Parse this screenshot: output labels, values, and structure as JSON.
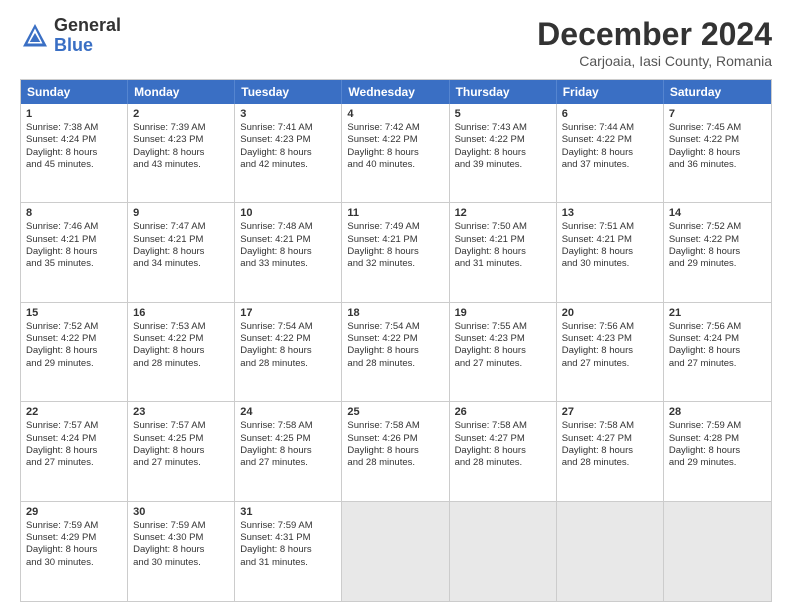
{
  "logo": {
    "line1": "General",
    "line2": "Blue"
  },
  "title": "December 2024",
  "subtitle": "Carjoaia, Iasi County, Romania",
  "header_days": [
    "Sunday",
    "Monday",
    "Tuesday",
    "Wednesday",
    "Thursday",
    "Friday",
    "Saturday"
  ],
  "weeks": [
    [
      {
        "day": "1",
        "text": "Sunrise: 7:38 AM\nSunset: 4:24 PM\nDaylight: 8 hours\nand 45 minutes."
      },
      {
        "day": "2",
        "text": "Sunrise: 7:39 AM\nSunset: 4:23 PM\nDaylight: 8 hours\nand 43 minutes."
      },
      {
        "day": "3",
        "text": "Sunrise: 7:41 AM\nSunset: 4:23 PM\nDaylight: 8 hours\nand 42 minutes."
      },
      {
        "day": "4",
        "text": "Sunrise: 7:42 AM\nSunset: 4:22 PM\nDaylight: 8 hours\nand 40 minutes."
      },
      {
        "day": "5",
        "text": "Sunrise: 7:43 AM\nSunset: 4:22 PM\nDaylight: 8 hours\nand 39 minutes."
      },
      {
        "day": "6",
        "text": "Sunrise: 7:44 AM\nSunset: 4:22 PM\nDaylight: 8 hours\nand 37 minutes."
      },
      {
        "day": "7",
        "text": "Sunrise: 7:45 AM\nSunset: 4:22 PM\nDaylight: 8 hours\nand 36 minutes."
      }
    ],
    [
      {
        "day": "8",
        "text": "Sunrise: 7:46 AM\nSunset: 4:21 PM\nDaylight: 8 hours\nand 35 minutes."
      },
      {
        "day": "9",
        "text": "Sunrise: 7:47 AM\nSunset: 4:21 PM\nDaylight: 8 hours\nand 34 minutes."
      },
      {
        "day": "10",
        "text": "Sunrise: 7:48 AM\nSunset: 4:21 PM\nDaylight: 8 hours\nand 33 minutes."
      },
      {
        "day": "11",
        "text": "Sunrise: 7:49 AM\nSunset: 4:21 PM\nDaylight: 8 hours\nand 32 minutes."
      },
      {
        "day": "12",
        "text": "Sunrise: 7:50 AM\nSunset: 4:21 PM\nDaylight: 8 hours\nand 31 minutes."
      },
      {
        "day": "13",
        "text": "Sunrise: 7:51 AM\nSunset: 4:21 PM\nDaylight: 8 hours\nand 30 minutes."
      },
      {
        "day": "14",
        "text": "Sunrise: 7:52 AM\nSunset: 4:22 PM\nDaylight: 8 hours\nand 29 minutes."
      }
    ],
    [
      {
        "day": "15",
        "text": "Sunrise: 7:52 AM\nSunset: 4:22 PM\nDaylight: 8 hours\nand 29 minutes."
      },
      {
        "day": "16",
        "text": "Sunrise: 7:53 AM\nSunset: 4:22 PM\nDaylight: 8 hours\nand 28 minutes."
      },
      {
        "day": "17",
        "text": "Sunrise: 7:54 AM\nSunset: 4:22 PM\nDaylight: 8 hours\nand 28 minutes."
      },
      {
        "day": "18",
        "text": "Sunrise: 7:54 AM\nSunset: 4:22 PM\nDaylight: 8 hours\nand 28 minutes."
      },
      {
        "day": "19",
        "text": "Sunrise: 7:55 AM\nSunset: 4:23 PM\nDaylight: 8 hours\nand 27 minutes."
      },
      {
        "day": "20",
        "text": "Sunrise: 7:56 AM\nSunset: 4:23 PM\nDaylight: 8 hours\nand 27 minutes."
      },
      {
        "day": "21",
        "text": "Sunrise: 7:56 AM\nSunset: 4:24 PM\nDaylight: 8 hours\nand 27 minutes."
      }
    ],
    [
      {
        "day": "22",
        "text": "Sunrise: 7:57 AM\nSunset: 4:24 PM\nDaylight: 8 hours\nand 27 minutes."
      },
      {
        "day": "23",
        "text": "Sunrise: 7:57 AM\nSunset: 4:25 PM\nDaylight: 8 hours\nand 27 minutes."
      },
      {
        "day": "24",
        "text": "Sunrise: 7:58 AM\nSunset: 4:25 PM\nDaylight: 8 hours\nand 27 minutes."
      },
      {
        "day": "25",
        "text": "Sunrise: 7:58 AM\nSunset: 4:26 PM\nDaylight: 8 hours\nand 28 minutes."
      },
      {
        "day": "26",
        "text": "Sunrise: 7:58 AM\nSunset: 4:27 PM\nDaylight: 8 hours\nand 28 minutes."
      },
      {
        "day": "27",
        "text": "Sunrise: 7:58 AM\nSunset: 4:27 PM\nDaylight: 8 hours\nand 28 minutes."
      },
      {
        "day": "28",
        "text": "Sunrise: 7:59 AM\nSunset: 4:28 PM\nDaylight: 8 hours\nand 29 minutes."
      }
    ],
    [
      {
        "day": "29",
        "text": "Sunrise: 7:59 AM\nSunset: 4:29 PM\nDaylight: 8 hours\nand 30 minutes."
      },
      {
        "day": "30",
        "text": "Sunrise: 7:59 AM\nSunset: 4:30 PM\nDaylight: 8 hours\nand 30 minutes."
      },
      {
        "day": "31",
        "text": "Sunrise: 7:59 AM\nSunset: 4:31 PM\nDaylight: 8 hours\nand 31 minutes."
      },
      {
        "day": "",
        "text": ""
      },
      {
        "day": "",
        "text": ""
      },
      {
        "day": "",
        "text": ""
      },
      {
        "day": "",
        "text": ""
      }
    ]
  ]
}
